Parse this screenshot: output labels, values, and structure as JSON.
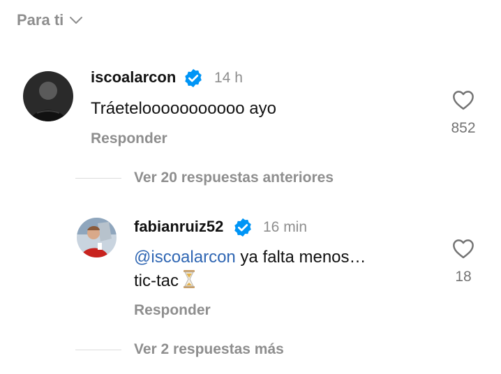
{
  "filter": {
    "label": "Para ti"
  },
  "comments": [
    {
      "username": "iscoalarcon",
      "time": "14 h",
      "text": "Tráetelooooooooooo ayo",
      "reply_label": "Responder",
      "likes": "852"
    }
  ],
  "thread": {
    "earlier_label": "Ver 20 respuestas anteriores",
    "reply": {
      "username": "fabianruiz52",
      "time": "16 min",
      "mention": "@iscoalarcon",
      "text_line1": " ya falta menos…",
      "text_line2": "tic-tac",
      "reply_label": "Responder",
      "likes": "18"
    },
    "more_label": "Ver 2 respuestas más"
  },
  "colors": {
    "verified": "#0095f6",
    "mention": "#2f66b3",
    "muted": "#8e8e8e"
  },
  "icons": [
    "chevron-down-icon",
    "verified-badge-icon",
    "heart-icon",
    "hourglass-icon"
  ]
}
